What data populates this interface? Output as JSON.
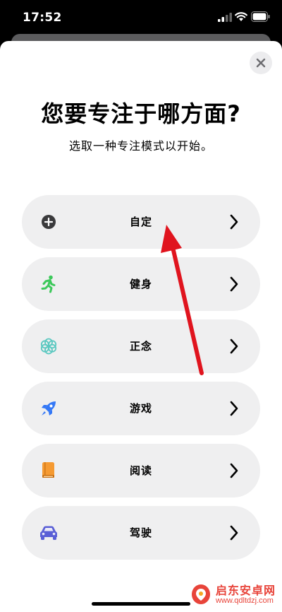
{
  "status_bar": {
    "time": "17:52"
  },
  "modal": {
    "title": "您要专注于哪方面?",
    "subtitle": "选取一种专注模式以开始。"
  },
  "options": [
    {
      "label": "自定",
      "icon": "plus-circle-icon",
      "color": "#333333"
    },
    {
      "label": "健身",
      "icon": "running-figure-icon",
      "color": "#3cc85a"
    },
    {
      "label": "正念",
      "icon": "flower-icon",
      "color": "#5ac8c0"
    },
    {
      "label": "游戏",
      "icon": "rocket-icon",
      "color": "#3478f6"
    },
    {
      "label": "阅读",
      "icon": "book-icon",
      "color": "#f59a32"
    },
    {
      "label": "驾驶",
      "icon": "car-icon",
      "color": "#5a5fd6"
    }
  ],
  "annotation": {
    "color": "#e0141e"
  },
  "watermark": {
    "name": "启东安卓网",
    "url": "www.qdltdzj.com"
  }
}
